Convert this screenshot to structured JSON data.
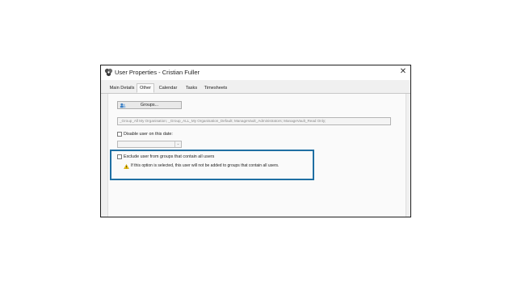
{
  "window": {
    "title": "User Properties - Cristian Fuller",
    "close_glyph": "✕"
  },
  "tabs": [
    {
      "label": "Main Details",
      "active": false
    },
    {
      "label": "Other",
      "active": true
    },
    {
      "label": "Calendar",
      "active": false
    },
    {
      "label": "Tasks",
      "active": false
    },
    {
      "label": "Timesheets",
      "active": false
    }
  ],
  "other": {
    "groups_button_label": "Groups...",
    "groups_value": "_Group_All My Organisation; _Group_ALL_My Organisation_Default; ManageVault_Administrators; ManageVault_Read Only;",
    "disable_user_label": "Disable user on this date:",
    "disable_user_checked": false,
    "date_value": "",
    "date_dropdown_glyph": "⌄",
    "exclude_label": "Exclude user from groups that contain all users",
    "exclude_checked": false,
    "exclude_warning": "If this option is selected, this user will not be added to groups that contain all users."
  },
  "colors": {
    "highlight": "#1f6fa3",
    "warning": "#f2c200"
  },
  "icons": {
    "app": "app-logo-icon",
    "groups": "groups-icon",
    "warning": "warning-icon",
    "close": "close-icon"
  }
}
